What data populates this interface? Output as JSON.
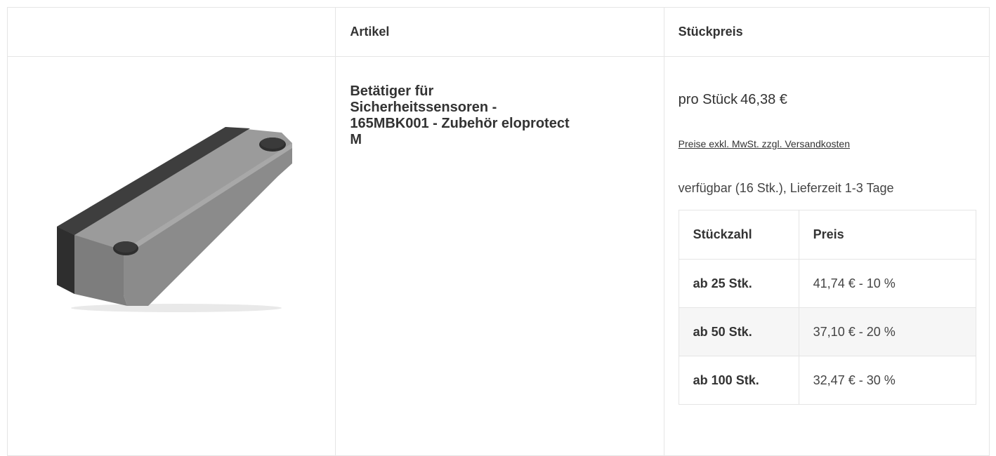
{
  "table": {
    "header": {
      "image_col": "",
      "article_col": "Artikel",
      "price_col": "Stückpreis"
    }
  },
  "product": {
    "title": "Betätiger für Sicherheitssensoren - 165MBK001 - Zubehör eloprotect M",
    "unit_price_label": "pro Stück",
    "unit_price": "46,38 €",
    "tax_note_link": "Preise exkl. MwSt. zzgl. Versandkosten",
    "availability": "verfügbar (16 Stk.), Lieferzeit 1-3 Tage",
    "image": {
      "icon": "product-photo",
      "colors": {
        "body": "#8f8f8f",
        "top": "#9a9a9a",
        "strip": "#3d3d3d",
        "magnet": "#2e2e2e"
      }
    }
  },
  "scale_prices": {
    "headers": [
      "Stückzahl",
      "Preis"
    ],
    "rows": [
      {
        "qty": "ab 25 Stk.",
        "price": "41,74 € - 10 %"
      },
      {
        "qty": "ab 50 Stk.",
        "price": "37,10 € - 20 %"
      },
      {
        "qty": "ab 100 Stk.",
        "price": "32,47 € - 30 %"
      }
    ]
  }
}
